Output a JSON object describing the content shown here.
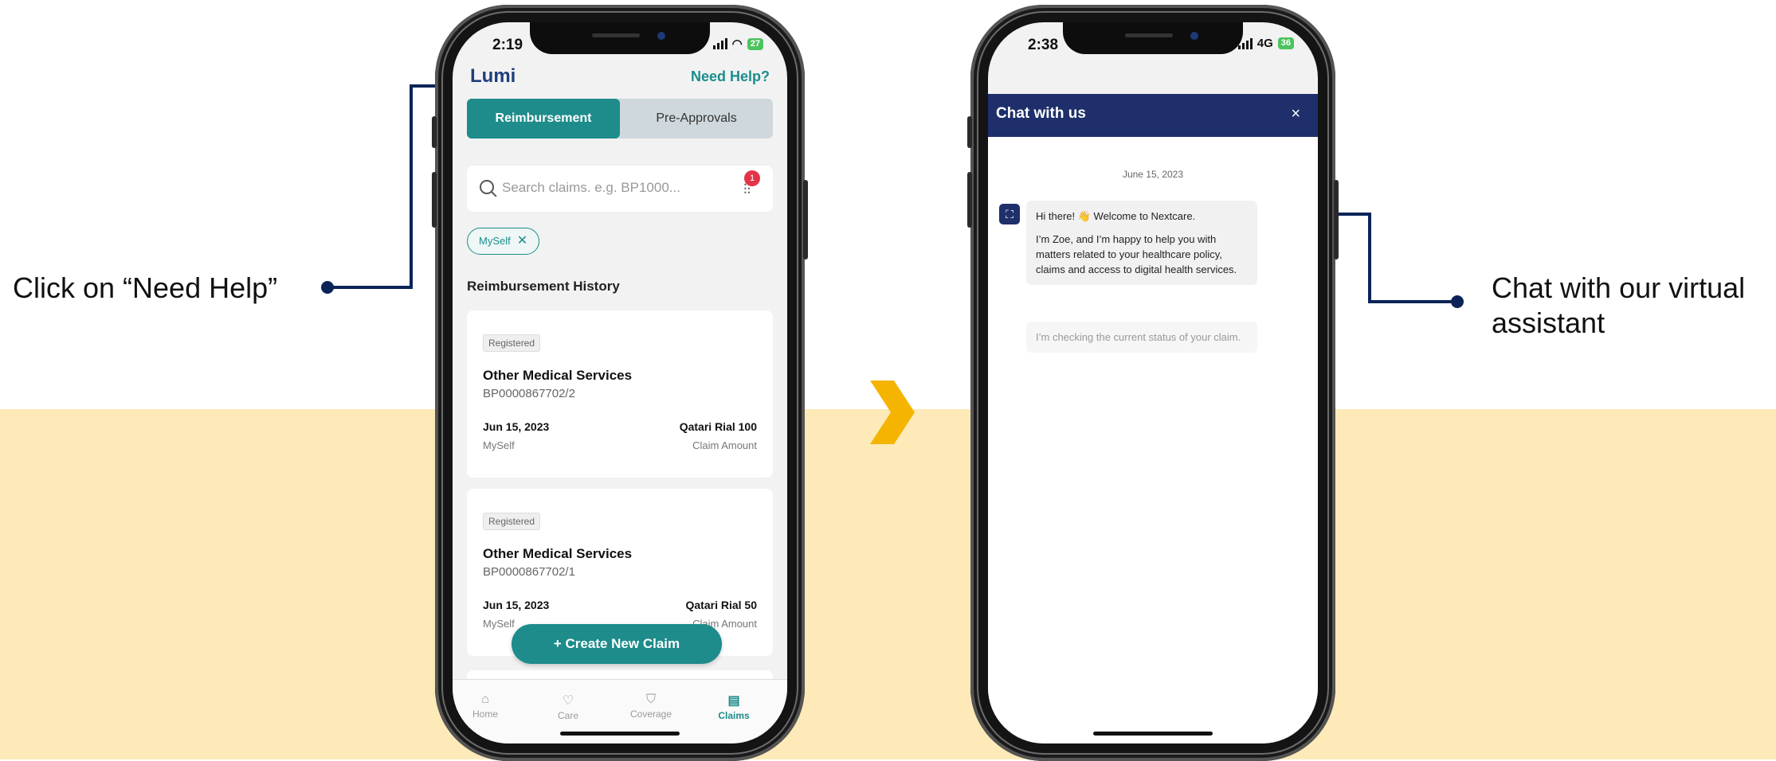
{
  "callouts": {
    "left_text": "Click on “Need Help”",
    "right_text_line1": "Chat with our virtual",
    "right_text_line2": "assistant"
  },
  "phone_left": {
    "status_time": "2:19",
    "battery": "27",
    "app_name": "Lumi",
    "need_help": "Need Help?",
    "tabs": [
      "Reimbursement",
      "Pre-Approvals"
    ],
    "search_placeholder": "Search claims. e.g. BP1000...",
    "filter_badge": "1",
    "filter_chip": "MySelf",
    "section_title": "Reimbursement History",
    "claims": [
      {
        "status": "Registered",
        "title": "Other Medical Services",
        "ref": "BP0000867702/2",
        "date": "Jun 15, 2023",
        "member": "MySelf",
        "amount": "Qatari Rial 100",
        "amount_label": "Claim Amount"
      },
      {
        "status": "Registered",
        "title": "Other Medical Services",
        "ref": "BP0000867702/1",
        "date": "Jun 15, 2023",
        "member": "MySelf",
        "amount": "Qatari Rial 50",
        "amount_label": "Claim Amount"
      }
    ],
    "create_button": "+   Create New Claim",
    "nav": [
      "Home",
      "Care",
      "Coverage",
      "Claims"
    ]
  },
  "phone_right": {
    "status_time": "2:38",
    "network": "4G",
    "battery": "36",
    "chat_title": "Chat with us",
    "close": "×",
    "date": "June 15, 2023",
    "msg1_line1": "Hi there! 👋 Welcome to Nextcare.",
    "msg1_line2": "I’m Zoe, and I’m happy to help you with matters related to your healthcare policy, claims and access to digital health services.",
    "msg2": "I’m checking the current status of your claim."
  }
}
